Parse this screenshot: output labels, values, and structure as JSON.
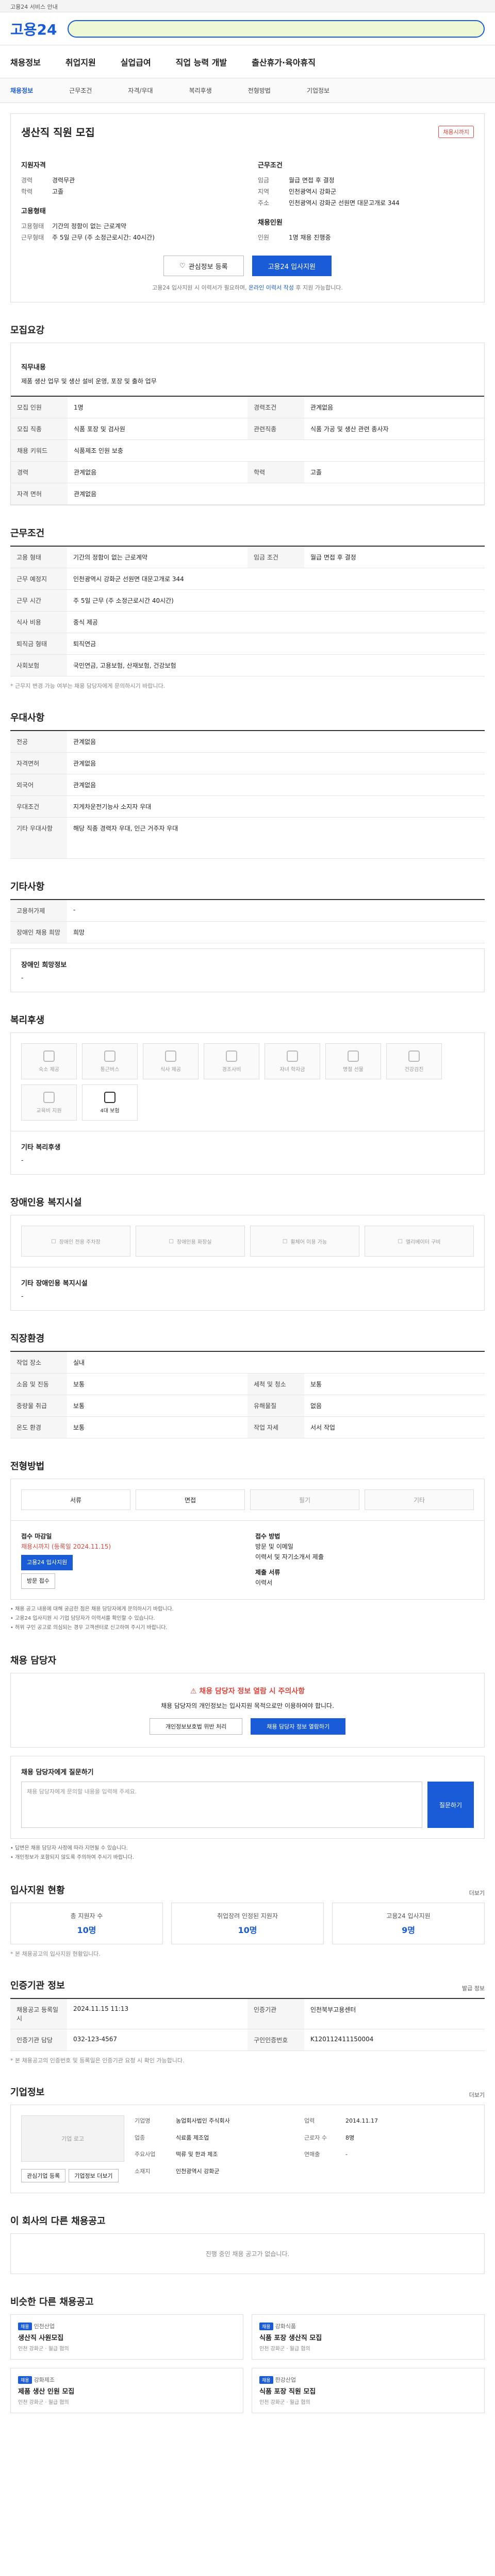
{
  "topbar": {
    "text": "고용24 서비스 안내"
  },
  "header": {
    "logo": "고용24"
  },
  "nav": [
    "채용정보",
    "취업지원",
    "실업급여",
    "직업 능력 개발",
    "출산휴가·육아휴직"
  ],
  "sub_nav": [
    "채용정보",
    "근무조건",
    "자격/우대",
    "복리후생",
    "전형방법",
    "기업정보"
  ],
  "job": {
    "title": "생산직 직원 모집",
    "badge": "채용시까지",
    "left_label": "지원자격",
    "left_rows": [
      {
        "k": "경력",
        "v": "경력무관"
      },
      {
        "k": "학력",
        "v": "고졸"
      }
    ],
    "left_label2": "고용형태",
    "left_rows2": [
      {
        "k": "고용형태",
        "v": "기간의 정함이 없는 근로계약"
      },
      {
        "k": "근무형태",
        "v": "주 5일 근무 (주 소정근로시간: 40시간)"
      }
    ],
    "right_label": "근무조건",
    "right_rows": [
      {
        "k": "임금",
        "v": "월급 면접 후 결정"
      },
      {
        "k": "지역",
        "v": "인천광역시 강화군"
      },
      {
        "k": "주소",
        "v": "인천광역시 강화군 선원면 대문고개로 344"
      }
    ],
    "right_label2": "채용인원",
    "right_rows2": [
      {
        "k": "인원",
        "v": "1명 채용 진행중"
      }
    ],
    "scrap_btn": "관심정보 등록",
    "apply_btn": "고용24 입사지원",
    "note_a": "고용24 입사지원 시 이력서가 필요하며, ",
    "note_b": "온라인 이력서 작성",
    "note_c": " 후 지원 가능합니다."
  },
  "recruit": {
    "title": "모집요강",
    "desc_label": "직무내용",
    "desc": "제품 생산 업무 및 생산 설비 운영, 포장 및 출하 업무",
    "rows": [
      {
        "k": "모집 인원",
        "v": "1명",
        "k2": "경력조건",
        "v2": "관계없음"
      },
      {
        "k": "모집 직종",
        "v": "식품 포장 및 검사원",
        "k2": "관련직종",
        "v2": "식품 가공 및 생산 관련 종사자"
      },
      {
        "k": "채용 키워드",
        "v": "식품제조 인원 보충"
      },
      {
        "k": "경력",
        "v": "관계없음",
        "k2": "학력",
        "v2": "고졸"
      },
      {
        "k": "자격 면허",
        "v": "관계없음"
      }
    ]
  },
  "conditions": {
    "title": "근무조건",
    "rows": [
      {
        "k": "고용 형태",
        "v": "기간의 정함이 없는 근로계약",
        "k2": "임금 조건",
        "v2": "월급 면접 후 결정"
      },
      {
        "k": "근무 예정지",
        "v": "인천광역시 강화군 선원면 대문고개로 344"
      },
      {
        "k": "근무 시간",
        "v": "주 5일 근무 (주 소정근로시간 40시간)"
      },
      {
        "k": "식사 비용",
        "v": "중식 제공"
      },
      {
        "k": "퇴직금 형태",
        "v": "퇴직연금"
      },
      {
        "k": "사회보험",
        "v": "국민연금, 고용보험, 산재보험, 건강보험"
      }
    ],
    "note": "* 근무지 변경 가능 여부는 채용 담당자에게 문의하시기 바랍니다."
  },
  "qualification": {
    "title": "우대사항",
    "rows": [
      {
        "k": "전공",
        "v": "관계없음"
      },
      {
        "k": "자격면허",
        "v": "관계없음"
      },
      {
        "k": "외국어",
        "v": "관계없음"
      },
      {
        "k": "우대조건",
        "v": "지게차운전기능사 소지자 우대"
      },
      {
        "k": "기타 우대사항",
        "v": "해당 직종 경력자 우대, 인근 거주자 우대"
      }
    ]
  },
  "other": {
    "title": "기타사항",
    "rows": [
      {
        "k": "고용허가제",
        "v": "-"
      },
      {
        "k": "장애인 채용 희망",
        "v": "희망"
      }
    ],
    "disability_title": "장애인 희망정보",
    "disability_value": "-"
  },
  "welfare": {
    "title": "복리후생",
    "items": [
      "숙소 제공",
      "통근버스",
      "식사 제공",
      "경조사비",
      "자녀 학자금",
      "명절 선물",
      "건강검진",
      "교육비 지원",
      "4대 보험"
    ],
    "active_index": 8,
    "etc_label": "기타 복리후생",
    "etc_value": "-"
  },
  "disabled_facility": {
    "title": "장애인용 복지시설",
    "items": [
      "장애인 전용 주차장",
      "장애인용 화장실",
      "휠체어 이용 가능",
      "엘리베이터 구비"
    ],
    "etc_label": "기타 장애인용 복지시설",
    "etc_value": "-"
  },
  "workplace": {
    "title": "직장환경",
    "rows": [
      {
        "k": "작업 장소",
        "v": "실내",
        "k2": "",
        "v2": ""
      },
      {
        "k": "소음 및 진동",
        "v": "보통",
        "k2": "세척 및 청소",
        "v2": "보통"
      },
      {
        "k": "중량물 취급",
        "v": "보통",
        "k2": "유해물질",
        "v2": "없음"
      },
      {
        "k": "온도 환경",
        "v": "보통",
        "k2": "작업 자세",
        "v2": "서서 작업"
      }
    ]
  },
  "selection": {
    "title": "전형방법",
    "methods": [
      "서류",
      "면접",
      "필기",
      "기타"
    ],
    "active": [
      0,
      1
    ],
    "apply_label": "접수 마감일",
    "apply_deadline": "채용시까지 (등록일 2024.11.15)",
    "apply_btn": "고용24 입사지원",
    "apply_btn2": "방문 접수",
    "method_label": "접수 방법",
    "method_v1": "방문 및 이메일",
    "method_v2": "이력서 및 자기소개서 제출",
    "docs_label": "제출 서류",
    "docs_v": "이력서",
    "notices": [
      "• 채용 공고 내용에 대해 궁금한 점은 채용 담당자에게 문의하시기 바랍니다.",
      "• 고용24 입사지원 시 기업 담당자가 이력서를 확인할 수 있습니다.",
      "• 허위 구인 공고로 의심되는 경우 고객센터로 신고하여 주시기 바랍니다."
    ]
  },
  "contact": {
    "title": "채용 담당자",
    "warn_title": "채용 담당자 정보 열람 시 주의사항",
    "warn_body": "채용 담당자의 개인정보는 입사지원 목적으로만 이용하여야 합니다.",
    "btn1": "개인정보보호법 위반 처리",
    "btn2": "채용 담당자 정보 열람하기",
    "q_label": "채용 담당자에게 질문하기",
    "placeholder": "채용 담당자에게 문의할 내용을 입력해 주세요.",
    "send": "질문하기",
    "notes": [
      "• 답변은 채용 담당자 사정에 따라 지연될 수 있습니다.",
      "• 개인정보가 포함되지 않도록 주의하여 주시기 바랍니다."
    ]
  },
  "stats": {
    "title": "입사지원 현황",
    "more": "더보기",
    "items": [
      {
        "l": "총 지원자 수",
        "v": "10명"
      },
      {
        "l": "취업장려 인정된 지원자",
        "v": "10명"
      },
      {
        "l": "고용24 입사지원",
        "v": "9명"
      }
    ],
    "note": "* 본 채용공고의 입사지원 현황입니다."
  },
  "regist": {
    "title": "인증기관 정보",
    "more": "발급 정보",
    "rows": [
      {
        "k": "채용공고 등록일시",
        "v": "2024.11.15 11:13",
        "k2": "인증기관",
        "v2": "인천북부고용센터"
      },
      {
        "k": "인증기관 담당",
        "v": "032-123-4567",
        "k2": "구인인증번호",
        "v2": "K120112411150004"
      }
    ],
    "note": "* 본 채용공고의 인증번호 및 등록일은 인증기관 요청 시 확인 가능합니다."
  },
  "company": {
    "title": "기업정보",
    "more": "더보기",
    "logo_alt": "기업 로고",
    "rows": [
      {
        "k": "기업명",
        "v": "농업회사법인 주식회사",
        "k2": "업력",
        "v2": "2014.11.17"
      },
      {
        "k": "업종",
        "v": "식료품 제조업",
        "k2": "근로자 수",
        "v2": "8명"
      },
      {
        "k": "주요사업",
        "v": "떡류 및 한과 제조",
        "k2": "연매출",
        "v2": "-"
      },
      {
        "k": "소재지",
        "v": "인천광역시 강화군",
        "k2": "",
        "v2": ""
      }
    ],
    "btn1": "관심기업 등록",
    "btn2": "기업정보 더보기"
  },
  "same_company": {
    "title": "이 회사의 다른 채용공고",
    "empty": "진행 중인 채용 공고가 없습니다."
  },
  "recommend": {
    "title": "비슷한 다른 채용공고",
    "items": [
      {
        "tag": "채용",
        "co": "인천산업",
        "t": "생산직 사원모집",
        "m": "인천 강화군 · 월급 협의"
      },
      {
        "tag": "채용",
        "co": "강화식품",
        "t": "식품 포장 생산직 모집",
        "m": "인천 강화군 · 월급 협의"
      },
      {
        "tag": "채용",
        "co": "강화제조",
        "t": "제품 생산 인원 모집",
        "m": "인천 강화군 · 월급 협의"
      },
      {
        "tag": "채용",
        "co": "한강산업",
        "t": "식품 포장 직원 모집",
        "m": "인천 강화군 · 월급 협의"
      }
    ]
  }
}
